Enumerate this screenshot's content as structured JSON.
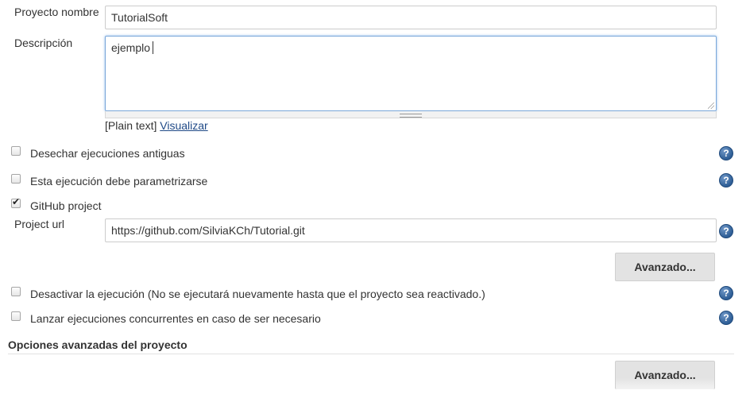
{
  "project": {
    "name_label": "Proyecto nombre",
    "name_value": "TutorialSoft",
    "description_label": "Descripción",
    "description_value": "ejemplo",
    "format_prefix": "[Plain text]",
    "preview_link": "Visualizar"
  },
  "options": {
    "discard_old_builds": "Desechar ejecuciones antiguas",
    "parameterized": "Esta ejecución debe parametrizarse",
    "github_project": "GitHub project",
    "disable_build": "Desactivar la ejecución (No se ejecutará nuevamente hasta que el proyecto sea reactivado.)",
    "concurrent_builds": "Lanzar ejecuciones concurrentes en caso de ser necesario"
  },
  "github": {
    "url_label": "Project url",
    "url_value": "https://github.com/SilviaKCh/Tutorial.git",
    "advanced_button": "Avanzado..."
  },
  "advanced_section": {
    "title": "Opciones avanzadas del proyecto",
    "advanced_button": "Avanzado..."
  },
  "help_glyph": "?",
  "checked_glyph": "✔",
  "colors": {
    "link": "#204a87",
    "help_icon": "#2e5e96",
    "button_bg": "#e3e3e3",
    "focus_border": "#7aa7d9"
  }
}
